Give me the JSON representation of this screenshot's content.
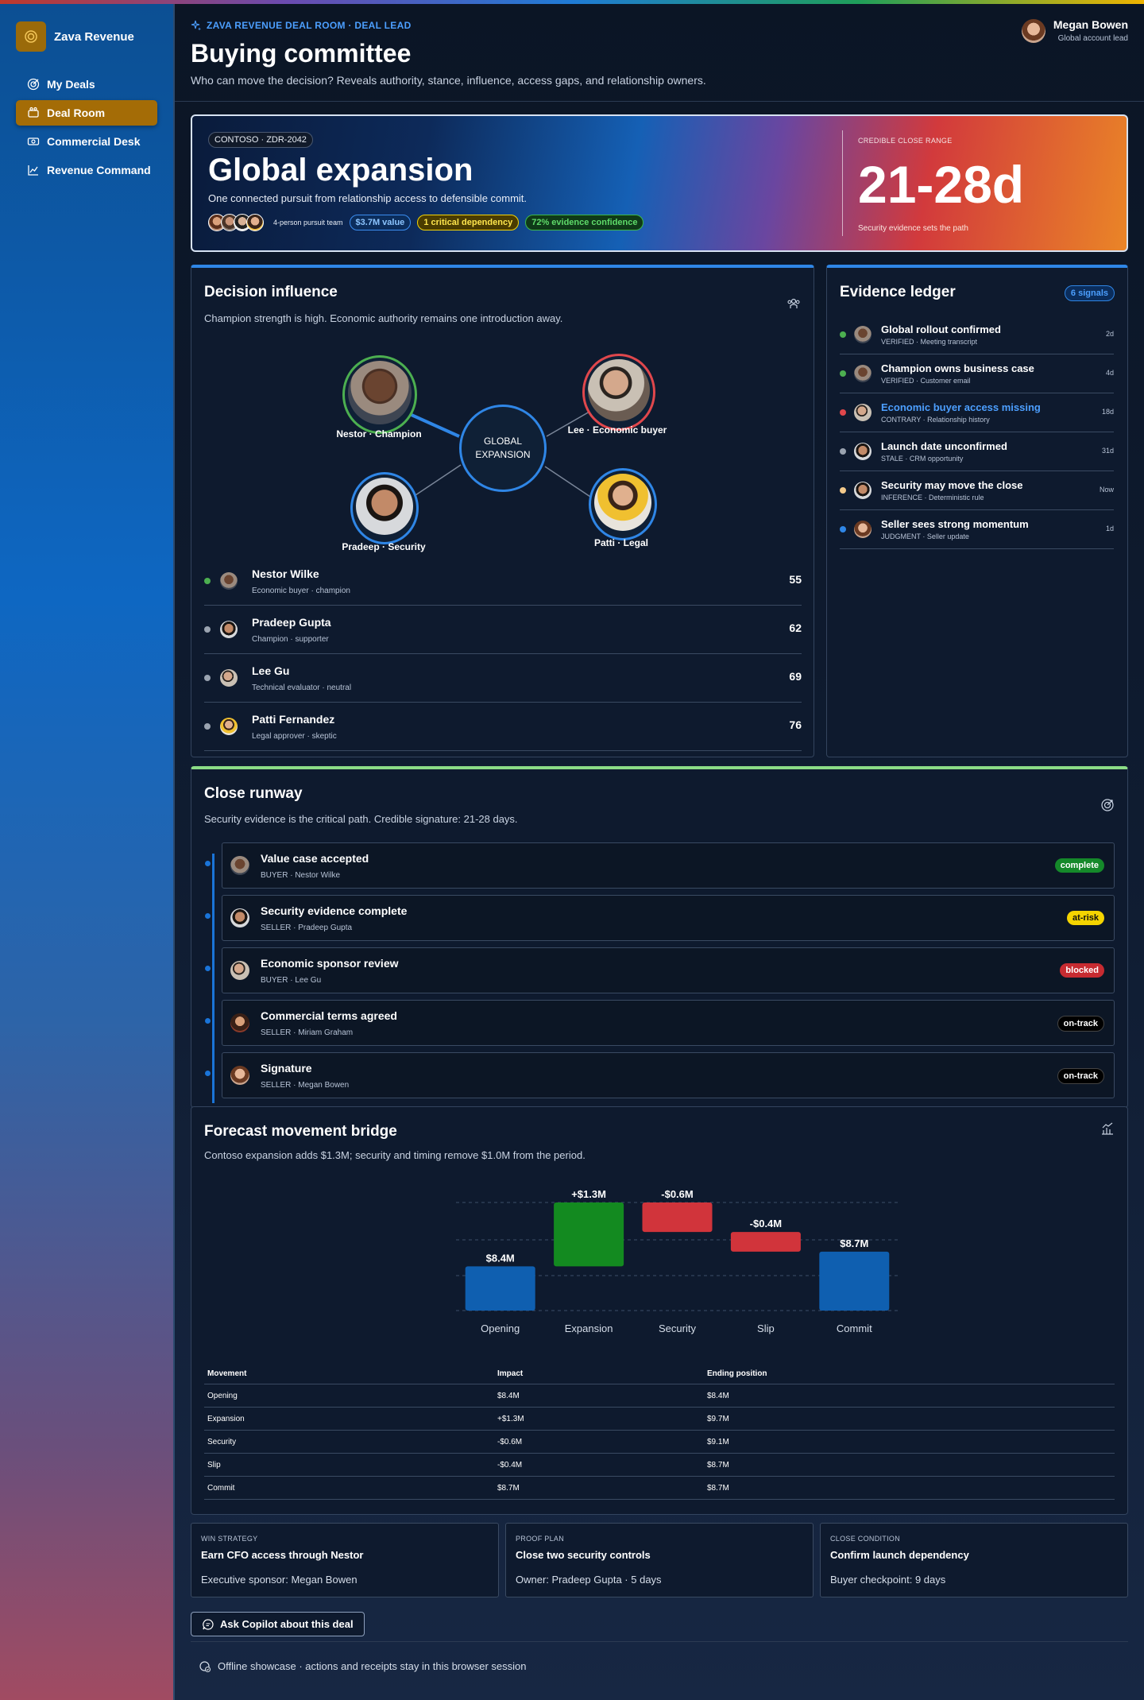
{
  "sidebar": {
    "brand": "Zava Revenue",
    "items": [
      {
        "label": "My Deals",
        "icon": "target-icon"
      },
      {
        "label": "Deal Room",
        "icon": "meeting-room-icon"
      },
      {
        "label": "Commercial Desk",
        "icon": "money-icon"
      },
      {
        "label": "Revenue Command",
        "icon": "chart-icon"
      }
    ],
    "active_index": 1
  },
  "header": {
    "eyebrow": "ZAVA REVENUE DEAL ROOM · DEAL LEAD",
    "title": "Buying committee",
    "subtitle": "Who can move the decision? Reveals authority, stance, influence, access gaps, and relationship owners.",
    "user": {
      "name": "Megan Bowen",
      "role": "Global account lead"
    }
  },
  "hero": {
    "code": "CONTOSO · ZDR-2042",
    "title": "Global expansion",
    "subtitle": "One connected pursuit from relationship access to defensible commit.",
    "team_label": "4-person pursuit team",
    "pills": [
      "$3.7M value",
      "1 critical dependency",
      "72% evidence confidence"
    ],
    "range_label": "CREDIBLE CLOSE RANGE",
    "range": "21-28d",
    "range_note": "Security evidence sets the path"
  },
  "influence": {
    "title": "Decision influence",
    "subtitle": "Champion strength is high. Economic authority remains one introduction away.",
    "center": "GLOBAL EXPANSION",
    "nodes": [
      {
        "label": "Nestor · Champion",
        "ring": "#4caf50"
      },
      {
        "label": "Lee · Economic buyer",
        "ring": "#e0474c"
      },
      {
        "label": "Pradeep · Security",
        "ring": "#2f86e6"
      },
      {
        "label": "Patti · Legal",
        "ring": "#2f86e6"
      }
    ],
    "people": [
      {
        "name": "Nestor Wilke",
        "role": "Economic buyer · champion",
        "score": "55",
        "dot": "#4caf50"
      },
      {
        "name": "Pradeep Gupta",
        "role": "Champion · supporter",
        "score": "62",
        "dot": "#9aa3b0"
      },
      {
        "name": "Lee Gu",
        "role": "Technical evaluator · neutral",
        "score": "69",
        "dot": "#9aa3b0"
      },
      {
        "name": "Patti Fernandez",
        "role": "Legal approver · skeptic",
        "score": "76",
        "dot": "#9aa3b0"
      }
    ]
  },
  "ledger": {
    "title": "Evidence ledger",
    "count": "6 signals",
    "items": [
      {
        "title": "Global rollout confirmed",
        "meta": "VERIFIED · Meeting transcript",
        "age": "2d",
        "dot": "#4caf50",
        "link": false
      },
      {
        "title": "Champion owns business case",
        "meta": "VERIFIED · Customer email",
        "age": "4d",
        "dot": "#4caf50",
        "link": false
      },
      {
        "title": "Economic buyer access missing",
        "meta": "CONTRARY · Relationship history",
        "age": "18d",
        "dot": "#e0474c",
        "link": true
      },
      {
        "title": "Launch date unconfirmed",
        "meta": "STALE · CRM opportunity",
        "age": "31d",
        "dot": "#9aa3b0",
        "link": false
      },
      {
        "title": "Security may move the close",
        "meta": "INFERENCE · Deterministic rule",
        "age": "Now",
        "dot": "#f3c98b",
        "link": false
      },
      {
        "title": "Seller sees strong momentum",
        "meta": "JUDGMENT · Seller update",
        "age": "1d",
        "dot": "#2f86e6",
        "link": false
      }
    ]
  },
  "runway": {
    "title": "Close runway",
    "subtitle": "Security evidence is the critical path. Credible signature: 21-28 days.",
    "milestones": [
      {
        "title": "Value case accepted",
        "meta": "BUYER · Nestor Wilke",
        "status": "complete"
      },
      {
        "title": "Security evidence complete",
        "meta": "SELLER · Pradeep Gupta",
        "status": "at-risk"
      },
      {
        "title": "Economic sponsor review",
        "meta": "BUYER · Lee Gu",
        "status": "blocked"
      },
      {
        "title": "Commercial terms agreed",
        "meta": "SELLER · Miriam Graham",
        "status": "on-track"
      },
      {
        "title": "Signature",
        "meta": "SELLER · Megan Bowen",
        "status": "on-track"
      }
    ]
  },
  "bridge": {
    "title": "Forecast movement bridge",
    "subtitle": "Contoso expansion adds $1.3M; security and timing remove $1.0M from the period.",
    "table_headers": [
      "Movement",
      "Impact",
      "Ending position"
    ],
    "rows": [
      [
        "Opening",
        "$8.4M",
        "$8.4M"
      ],
      [
        "Expansion",
        "+$1.3M",
        "$9.7M"
      ],
      [
        "Security",
        "-$0.6M",
        "$9.1M"
      ],
      [
        "Slip",
        "-$0.4M",
        "$8.7M"
      ],
      [
        "Commit",
        "$8.7M",
        "$8.7M"
      ]
    ]
  },
  "chart_data": {
    "type": "bar",
    "subtype": "waterfall",
    "categories": [
      "Opening",
      "Expansion",
      "Security",
      "Slip",
      "Commit"
    ],
    "values": [
      8.4,
      1.3,
      -0.6,
      -0.4,
      8.7
    ],
    "labels": [
      "$8.4M",
      "+$1.3M",
      "-$0.6M",
      "-$0.4M",
      "$8.7M"
    ],
    "kinds": [
      "total",
      "increase",
      "decrease",
      "decrease",
      "total"
    ],
    "colors": {
      "total": "#0f5fb0",
      "increase": "#138a20",
      "decrease": "#d1343b"
    },
    "ylim": [
      0,
      10
    ],
    "grid": true
  },
  "tiles": [
    {
      "label": "WIN STRATEGY",
      "title": "Earn CFO access through Nestor",
      "detail": "Executive sponsor: Megan Bowen"
    },
    {
      "label": "PROOF PLAN",
      "title": "Close two security controls",
      "detail": "Owner: Pradeep Gupta · 5 days"
    },
    {
      "label": "CLOSE CONDITION",
      "title": "Confirm launch dependency",
      "detail": "Buyer checkpoint: 9 days"
    }
  ],
  "copilot_button": "Ask Copilot about this deal",
  "footer": "Offline showcase · actions and receipts stay in this browser session"
}
